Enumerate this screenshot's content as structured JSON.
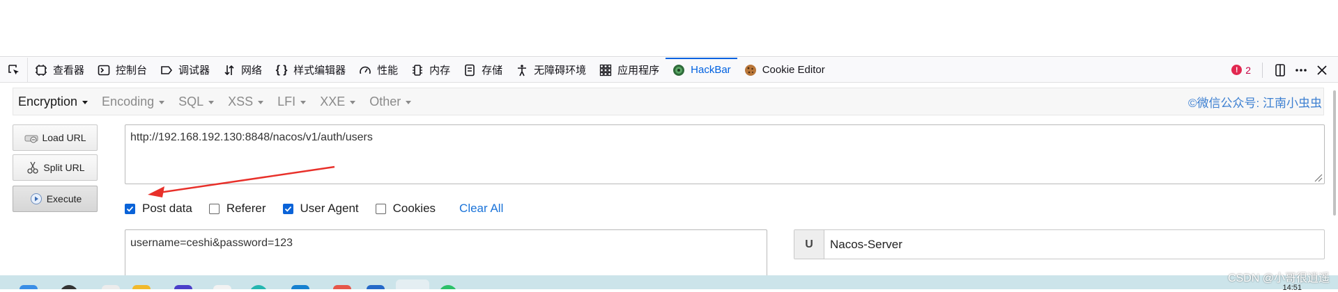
{
  "devtools": {
    "tabs": [
      {
        "label": "查看器",
        "icon": "inspector-icon"
      },
      {
        "label": "控制台",
        "icon": "console-icon"
      },
      {
        "label": "调试器",
        "icon": "debugger-icon"
      },
      {
        "label": "网络",
        "icon": "network-icon"
      },
      {
        "label": "样式编辑器",
        "icon": "style-editor-icon"
      },
      {
        "label": "性能",
        "icon": "performance-icon"
      },
      {
        "label": "内存",
        "icon": "memory-icon"
      },
      {
        "label": "存储",
        "icon": "storage-icon"
      },
      {
        "label": "无障碍环境",
        "icon": "accessibility-icon"
      },
      {
        "label": "应用程序",
        "icon": "application-icon"
      },
      {
        "label": "HackBar",
        "icon": "hackbar-icon",
        "active": true
      },
      {
        "label": "Cookie Editor",
        "icon": "cookie-icon"
      }
    ],
    "error_count": "2",
    "accent_color": "#0061e0"
  },
  "hackbar": {
    "menu": [
      {
        "label": "Encryption"
      },
      {
        "label": "Encoding"
      },
      {
        "label": "SQL"
      },
      {
        "label": "XSS"
      },
      {
        "label": "LFI"
      },
      {
        "label": "XXE"
      },
      {
        "label": "Other"
      }
    ],
    "credit": "©微信公众号: 江南小虫虫",
    "buttons": {
      "load_url": "Load URL",
      "split_url": "Split URL",
      "execute": "Execute"
    },
    "url_value": "http://192.168.192.130:8848/nacos/v1/auth/users",
    "options": [
      {
        "label": "Post data",
        "checked": true
      },
      {
        "label": "Referer",
        "checked": false
      },
      {
        "label": "User Agent",
        "checked": true
      },
      {
        "label": "Cookies",
        "checked": false
      }
    ],
    "clear_all": "Clear All",
    "post_value": "username=ceshi&password=123",
    "ua_label": "U",
    "ua_value": "Nacos-Server"
  },
  "watermark": "CSDN @小哥很逍遥",
  "clock": "14:51"
}
